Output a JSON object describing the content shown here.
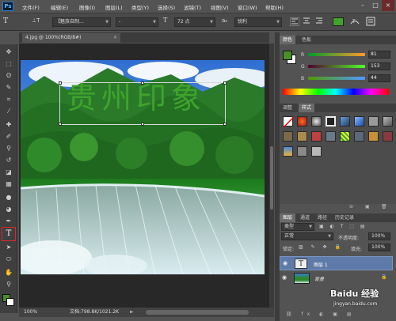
{
  "app": {
    "logo": "Ps"
  },
  "menus": [
    "文件(F)",
    "编辑(E)",
    "图像(I)",
    "图层(L)",
    "类型(Y)",
    "选择(S)",
    "滤镜(T)",
    "视图(V)",
    "窗口(W)",
    "帮助(H)"
  ],
  "window_controls": {
    "minimize": "–",
    "restore": "□",
    "close": "×"
  },
  "options_bar": {
    "tool_glyph": "T",
    "orient_glyph": "⊥T",
    "font_family": "【魅族自制...",
    "font_style": "-",
    "size_glyph": "T",
    "font_size": "72 点",
    "aa_glyph": "aₐ",
    "antialias": "锐利"
  },
  "document": {
    "tab_title": "4.jpg @ 100%(RGB/8#)",
    "close": "×",
    "text_layer_content": "贵州印象",
    "zoom": "100%",
    "doc_info": "文档:798.8K/1021.2K"
  },
  "colors": {
    "foreground": "#4a8f2a",
    "background": "#ffffff",
    "text": "#3fa32c",
    "highlight_tool": "#e0262d"
  },
  "color_panel": {
    "tabs": [
      "颜色",
      "色板"
    ],
    "r_label": "R",
    "r_value": "81",
    "g_label": "G",
    "g_value": "153",
    "b_label": "B",
    "b_value": "44"
  },
  "styles_panel": {
    "tabs": [
      "调整",
      "样式"
    ]
  },
  "layers_panel": {
    "tabs": [
      "图层",
      "通道",
      "路径",
      "历史记录"
    ],
    "filter_kind": "类型",
    "blend_mode": "正常",
    "opacity_label": "不透明度:",
    "opacity_value": "100%",
    "lock_label": "锁定:",
    "fill_label": "填充:",
    "fill_value": "100%",
    "layers": [
      {
        "thumb": "T",
        "name": "图层 1"
      },
      {
        "thumb": "",
        "name": "背景"
      }
    ]
  },
  "watermark": {
    "text": "Baidu 经验",
    "url": "jingyan.baidu.com"
  }
}
